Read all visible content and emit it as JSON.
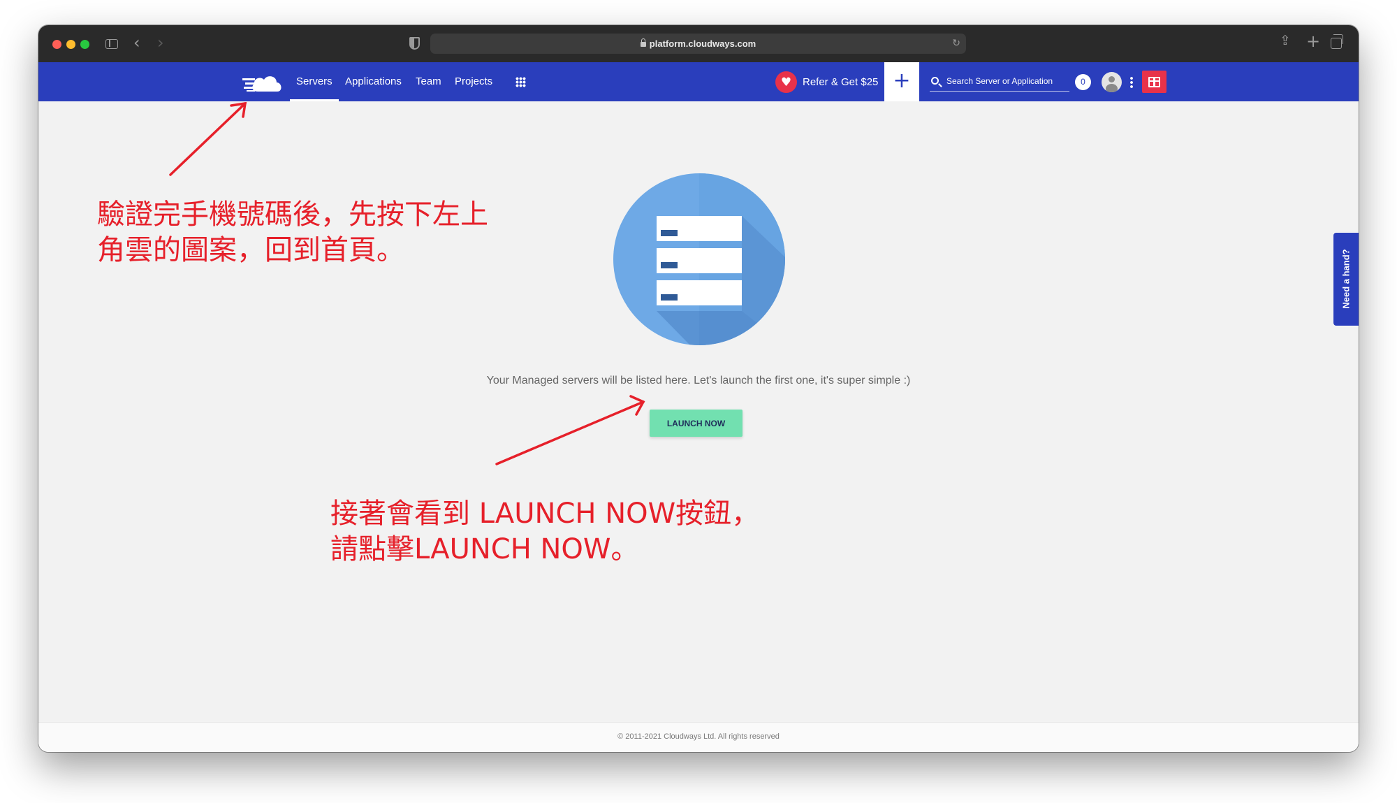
{
  "browser": {
    "url": "platform.cloudways.com",
    "icons": [
      "sidebar-toggle-icon",
      "back-icon",
      "forward-icon",
      "shield-icon",
      "lock-icon",
      "reload-icon",
      "share-icon",
      "new-tab-icon",
      "tabs-overview-icon"
    ],
    "back_glyph": "‹",
    "forward_glyph": "›",
    "reload_glyph": "↻",
    "share_glyph": "⇪",
    "newtab_glyph": "+"
  },
  "nav": {
    "brand_color": "#2a3ebc",
    "links": [
      {
        "label": "Servers",
        "active": true
      },
      {
        "label": "Applications"
      },
      {
        "label": "Team"
      },
      {
        "label": "Projects"
      }
    ],
    "refer_label": "Refer & Get $25",
    "heart_glyph": "♥",
    "add_glyph": "+",
    "search_placeholder": "Search Server or Application",
    "notification_count": "0"
  },
  "main": {
    "empty_message": "Your Managed servers will be listed here. Let's launch the first one, it's super simple :)",
    "launch_label": "LAUNCH NOW",
    "help_label": "Need a hand?",
    "accent_color": "#72e0b0"
  },
  "annotations": {
    "note_1_line_1": "驗證完手機號碼後，先按下左上",
    "note_1_line_2": "角雲的圖案，回到首頁。",
    "note_2_line_1": "接著會看到 LAUNCH NOW按鈕，",
    "note_2_line_2": "請點擊LAUNCH NOW。",
    "color": "#e6202a"
  },
  "footer": {
    "copyright": "© 2011-2021 Cloudways Ltd. All rights reserved"
  }
}
